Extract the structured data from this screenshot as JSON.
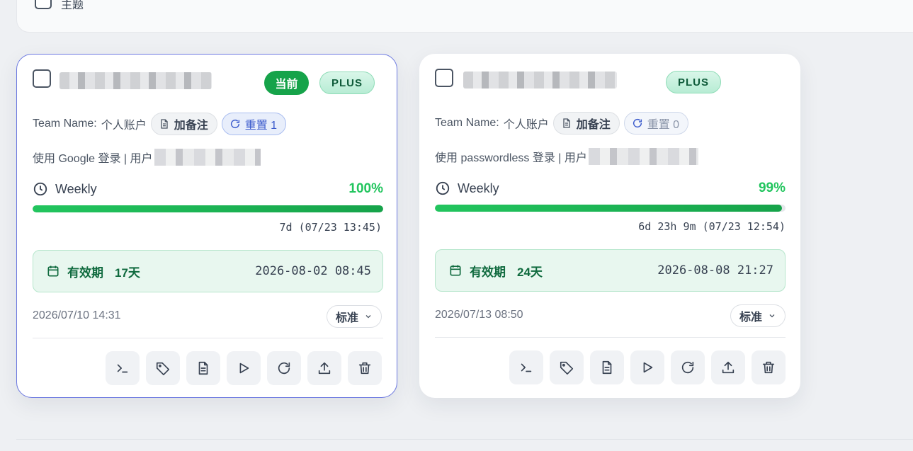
{
  "top": {
    "label": "主题"
  },
  "cards": [
    {
      "is_current": true,
      "current_badge": "当前",
      "plan_badge": "PLUS",
      "team_label": "Team Name:",
      "team_value": "个人账户",
      "note_label": "加备注",
      "reset_label": "重置 1",
      "login_text": "使用 Google 登录 | 用户",
      "usage_label": "Weekly",
      "usage_percent": "100%",
      "usage_fraction": 1.0,
      "reset_time": "7d (07/23 13:45)",
      "expiry_label": "有效期",
      "expiry_days": "17天",
      "expiry_date": "2026-08-02 08:45",
      "created": "2026/07/10 14:31",
      "plan_select": "标准"
    },
    {
      "is_current": false,
      "current_badge": "",
      "plan_badge": "PLUS",
      "team_label": "Team Name:",
      "team_value": "个人账户",
      "note_label": "加备注",
      "reset_label": "重置 0",
      "login_text": "使用 passwordless 登录 | 用户",
      "usage_label": "Weekly",
      "usage_percent": "99%",
      "usage_fraction": 0.99,
      "reset_time": "6d 23h 9m (07/23 12:54)",
      "expiry_label": "有效期",
      "expiry_days": "24天",
      "expiry_date": "2026-08-08 21:27",
      "created": "2026/07/13 08:50",
      "plan_select": "标准"
    }
  ],
  "actions": [
    "terminal-icon",
    "tag-icon",
    "document-icon",
    "play-icon",
    "refresh-icon",
    "upload-icon",
    "trash-icon"
  ],
  "colors": {
    "accent_green": "#22c55e",
    "current_border": "#6b78e0"
  }
}
